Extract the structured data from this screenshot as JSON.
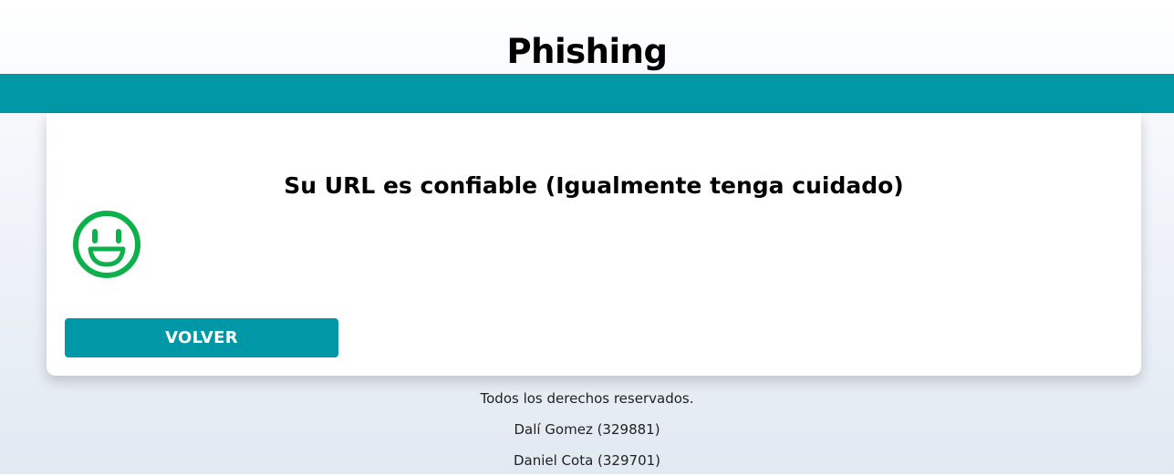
{
  "header": {
    "title": "Phishing"
  },
  "result": {
    "message": "Su URL es confiable (Igualmente tenga cuidado)",
    "icon": "smile-icon",
    "icon_color": "#0db14b",
    "back_label": "VOLVER"
  },
  "theme": {
    "accent": "#0097a7"
  },
  "footer": {
    "rights": "Todos los derechos reservados.",
    "authors": [
      "Dalí Gomez (329881)",
      "Daniel Cota (329701)"
    ]
  }
}
